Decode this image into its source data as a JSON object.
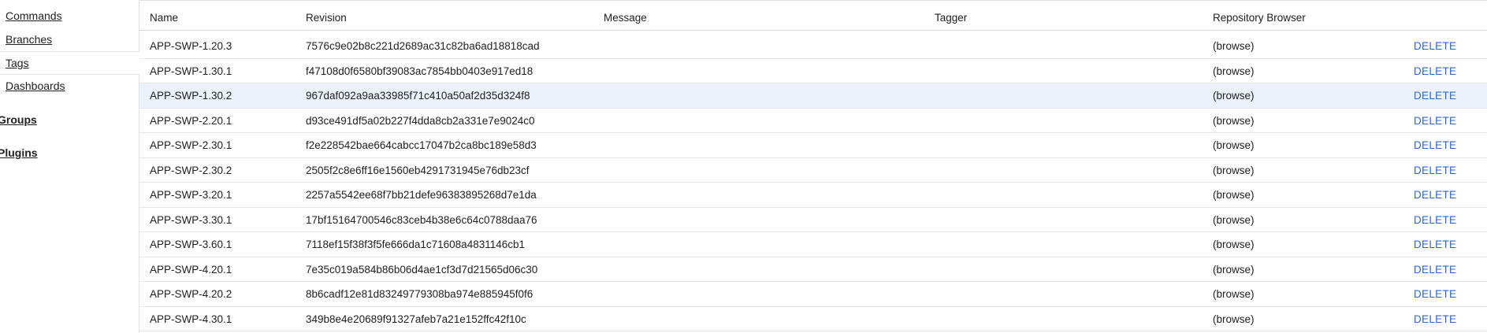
{
  "sidebar": {
    "items": [
      {
        "label": "Commands"
      },
      {
        "label": "Branches"
      },
      {
        "label": "Tags",
        "selected": true
      },
      {
        "label": "Dashboards"
      }
    ],
    "sections": [
      {
        "label": "Groups"
      },
      {
        "label": "Plugins"
      }
    ]
  },
  "table": {
    "headers": {
      "name": "Name",
      "revision": "Revision",
      "message": "Message",
      "tagger": "Tagger",
      "browser": "Repository Browser"
    },
    "rows": [
      {
        "name": "APP-SWP-1.20.3",
        "revision": "7576c9e02b8c221d2689ac31c82ba6ad18818cad",
        "browse": "(browse)",
        "delete": "DELETE"
      },
      {
        "name": "APP-SWP-1.30.1",
        "revision": "f47108d0f6580bf39083ac7854bb0403e917ed18",
        "browse": "(browse)",
        "delete": "DELETE"
      },
      {
        "name": "APP-SWP-1.30.2",
        "revision": "967daf092a9aa33985f71c410a50af2d35d324f8",
        "browse": "(browse)",
        "delete": "DELETE",
        "highlighted": true
      },
      {
        "name": "APP-SWP-2.20.1",
        "revision": "d93ce491df5a02b227f4dda8cb2a331e7e9024c0",
        "browse": "(browse)",
        "delete": "DELETE"
      },
      {
        "name": "APP-SWP-2.30.1",
        "revision": "f2e228542bae664cabcc17047b2ca8bc189e58d3",
        "browse": "(browse)",
        "delete": "DELETE"
      },
      {
        "name": "APP-SWP-2.30.2",
        "revision": "2505f2c8e6ff16e1560eb4291731945e76db23cf",
        "browse": "(browse)",
        "delete": "DELETE"
      },
      {
        "name": "APP-SWP-3.20.1",
        "revision": "2257a5542ee68f7bb21defe96383895268d7e1da",
        "browse": "(browse)",
        "delete": "DELETE"
      },
      {
        "name": "APP-SWP-3.30.1",
        "revision": "17bf15164700546c83ceb4b38e6c64c0788daa76",
        "browse": "(browse)",
        "delete": "DELETE"
      },
      {
        "name": "APP-SWP-3.60.1",
        "revision": "7118ef15f38f3f5fe666da1c71608a4831146cb1",
        "browse": "(browse)",
        "delete": "DELETE"
      },
      {
        "name": "APP-SWP-4.20.1",
        "revision": "7e35c019a584b86b06d4ae1cf3d7d21565d06c30",
        "browse": "(browse)",
        "delete": "DELETE"
      },
      {
        "name": "APP-SWP-4.20.2",
        "revision": "8b6cadf12e81d83249779308ba974e885945f0f6",
        "browse": "(browse)",
        "delete": "DELETE"
      },
      {
        "name": "APP-SWP-4.30.1",
        "revision": "349b8e4e20689f91327afeb7a21e152ffc42f10c",
        "browse": "(browse)",
        "delete": "DELETE"
      }
    ]
  },
  "colors": {
    "accent": "#2a66d9",
    "highlight_row": "#ebf2fc"
  }
}
